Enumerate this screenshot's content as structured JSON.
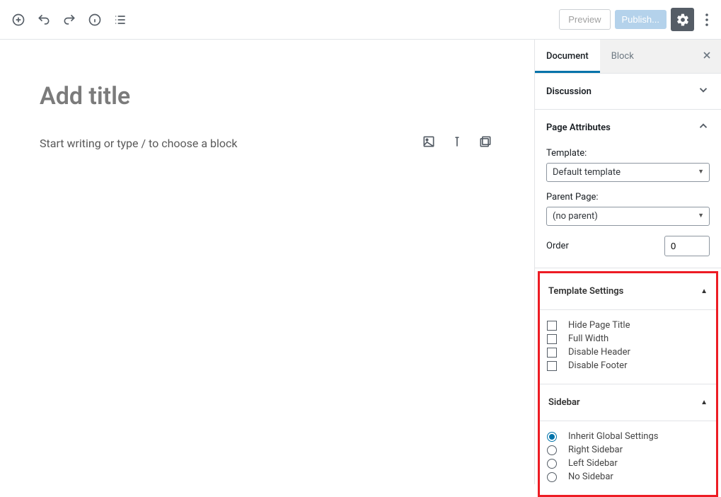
{
  "toolbar": {
    "preview_label": "Preview",
    "publish_label": "Publish..."
  },
  "editor": {
    "title_placeholder": "Add title",
    "body_placeholder": "Start writing or type / to choose a block"
  },
  "sidebar": {
    "tabs": {
      "document": "Document",
      "block": "Block"
    },
    "panels": {
      "discussion": {
        "title": "Discussion"
      },
      "page_attributes": {
        "title": "Page Attributes",
        "template_label": "Template:",
        "template_value": "Default template",
        "parent_label": "Parent Page:",
        "parent_value": "(no parent)",
        "order_label": "Order",
        "order_value": "0"
      },
      "template_settings": {
        "title": "Template Settings",
        "options": [
          "Hide Page Title",
          "Full Width",
          "Disable Header",
          "Disable Footer"
        ]
      },
      "sidebar_panel": {
        "title": "Sidebar",
        "options": [
          "Inherit Global Settings",
          "Right Sidebar",
          "Left Sidebar",
          "No Sidebar"
        ],
        "selected": 0
      }
    }
  }
}
